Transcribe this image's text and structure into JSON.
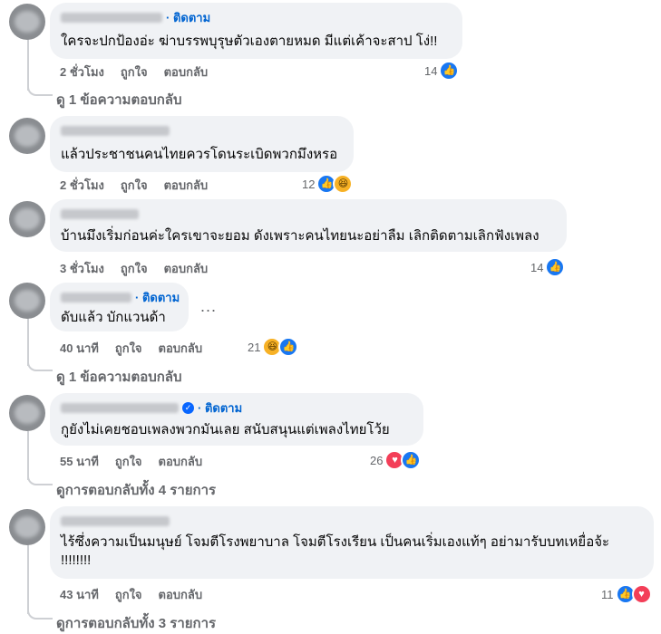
{
  "comments": [
    {
      "follow": "· ติดตาม",
      "text": "ใครจะปกป้องอ่ะ ฆ่าบรรพบุรุษตัวเองตายหมด มีแต่เค้าจะสาป โง่!!",
      "time": "2 ชั่วโมง",
      "like": "ถูกใจ",
      "reply": "ตอบกลับ",
      "count": "14",
      "icons": [
        "like-icon"
      ]
    },
    {
      "follow": "",
      "text": "แล้วประชาชนคนไทยควรโดนระเบิดพวกมึงหรอ",
      "time": "2 ชั่วโมง",
      "like": "ถูกใจ",
      "reply": "ตอบกลับ",
      "count": "12",
      "icons": [
        "like-icon",
        "haha-icon"
      ]
    },
    {
      "follow": "",
      "text": "บ้านมึงเริ่มก่อนค่ะใครเขาจะยอม ดังเพราะคนไทยนะอย่าลืม เลิกติดตามเลิกฟังเพลง",
      "time": "3 ชั่วโมง",
      "like": "ถูกใจ",
      "reply": "ตอบกลับ",
      "count": "14",
      "icons": [
        "like-icon"
      ]
    },
    {
      "follow": "· ติดตาม",
      "text": "ดับแล้ว บักแวนด้า",
      "time": "40 นาที",
      "like": "ถูกใจ",
      "reply": "ตอบกลับ",
      "count": "21",
      "icons": [
        "haha-icon",
        "like-icon"
      ],
      "more": "..."
    },
    {
      "follow": "· ติดตาม",
      "text": "กูยังไม่เคยชอบเพลงพวกมันเลย สนับสนุนแต่เพลงไทยโว้ย",
      "time": "55 นาที",
      "like": "ถูกใจ",
      "reply": "ตอบกลับ",
      "count": "26",
      "icons": [
        "love-icon",
        "like-icon"
      ]
    },
    {
      "follow": "",
      "text1": "ไร้ซึ่งความเป็นมนุษย์ โจมตีโรงพยาบาล โจมตีโรงเรียน เป็นคนเริ่มเองแท้ๆ อย่ามารับบทเหยื่อจ้ะ",
      "text2": "!!!!!!!!",
      "time": "43 นาที",
      "like": "ถูกใจ",
      "reply": "ตอบกลับ",
      "count": "11",
      "icons": [
        "like-icon",
        "love-icon"
      ]
    }
  ],
  "reply_links": {
    "r1": "ดู 1 ข้อความตอบกลับ",
    "r4": "ดู 1 ข้อความตอบกลับ",
    "r5": "ดูการตอบกลับทั้ง 4 รายการ",
    "r6": "ดูการตอบกลับทั้ง 3 รายการ"
  },
  "colors": {
    "bubble": "#f0f2f5",
    "link": "#0064d1",
    "meta": "#65676b",
    "like": "#1877f2",
    "love": "#f33e58",
    "haha": "#f7b125"
  }
}
